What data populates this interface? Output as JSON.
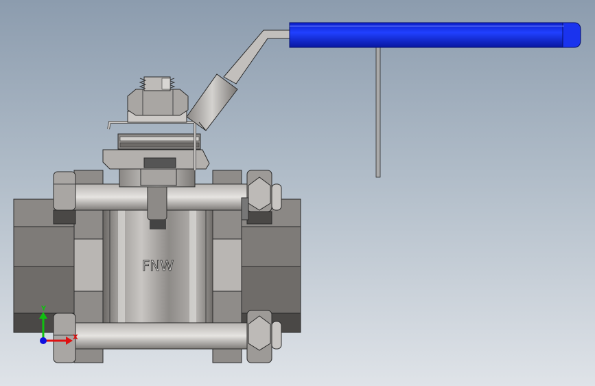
{
  "body_marking": "FNW",
  "triad": {
    "y_label": "Y",
    "x_label": "X"
  },
  "colors": {
    "background_top": "#8c9cae",
    "background_bottom": "#dfe3e8",
    "handle_grip": "#0a1ee0",
    "steel_dark": "#5a5855",
    "steel_mid": "#8a8784",
    "steel_light": "#c8c5c2",
    "axis_x": "#e01010",
    "axis_y": "#10c010",
    "axis_z": "#1010e0"
  },
  "icons": [
    "view-orientation-triad-icon"
  ]
}
